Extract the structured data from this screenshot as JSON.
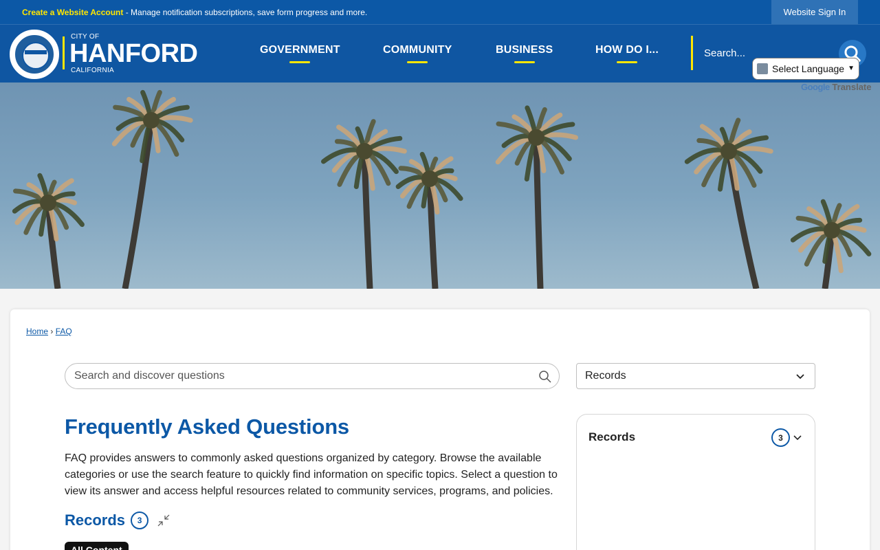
{
  "topbar": {
    "create_account_link": "Create a Website Account",
    "notice_text": " - Manage notification subscriptions, save form progress and more.",
    "sign_in": "Website Sign In"
  },
  "header": {
    "logo_city_of": "CITY OF",
    "logo_name": "HANFORD",
    "logo_state": "CALIFORNIA",
    "seal_icon": "city-seal",
    "nav": [
      {
        "label": "GOVERNMENT"
      },
      {
        "label": "COMMUNITY"
      },
      {
        "label": "BUSINESS"
      },
      {
        "label": "HOW DO I..."
      }
    ],
    "search_placeholder": "Search...",
    "search_icon": "magnifier-icon",
    "translate_select": "Select Language",
    "powered_by_google": "Google",
    "powered_by_translate": "Translate"
  },
  "hero": {
    "image": "palm-trees-against-sky"
  },
  "breadcrumb": {
    "home": "Home",
    "separator": "›",
    "current": "FAQ"
  },
  "faq": {
    "search_placeholder": "Search and discover questions",
    "category_selected": "Records",
    "title": "Frequently Asked Questions",
    "intro": "FAQ provides answers to commonly asked questions organized by category. Browse the available categories or use the search feature to quickly find information on specific topics. Select a question to view its answer and access helpful resources related to community services, programs, and policies.",
    "section_title": "Records",
    "section_count": "3",
    "tab_all": "All Content"
  },
  "side_panel": {
    "title": "Records",
    "count": "3"
  },
  "colors": {
    "brand_blue": "#0c58a6",
    "accent_yellow": "#ffe600"
  }
}
